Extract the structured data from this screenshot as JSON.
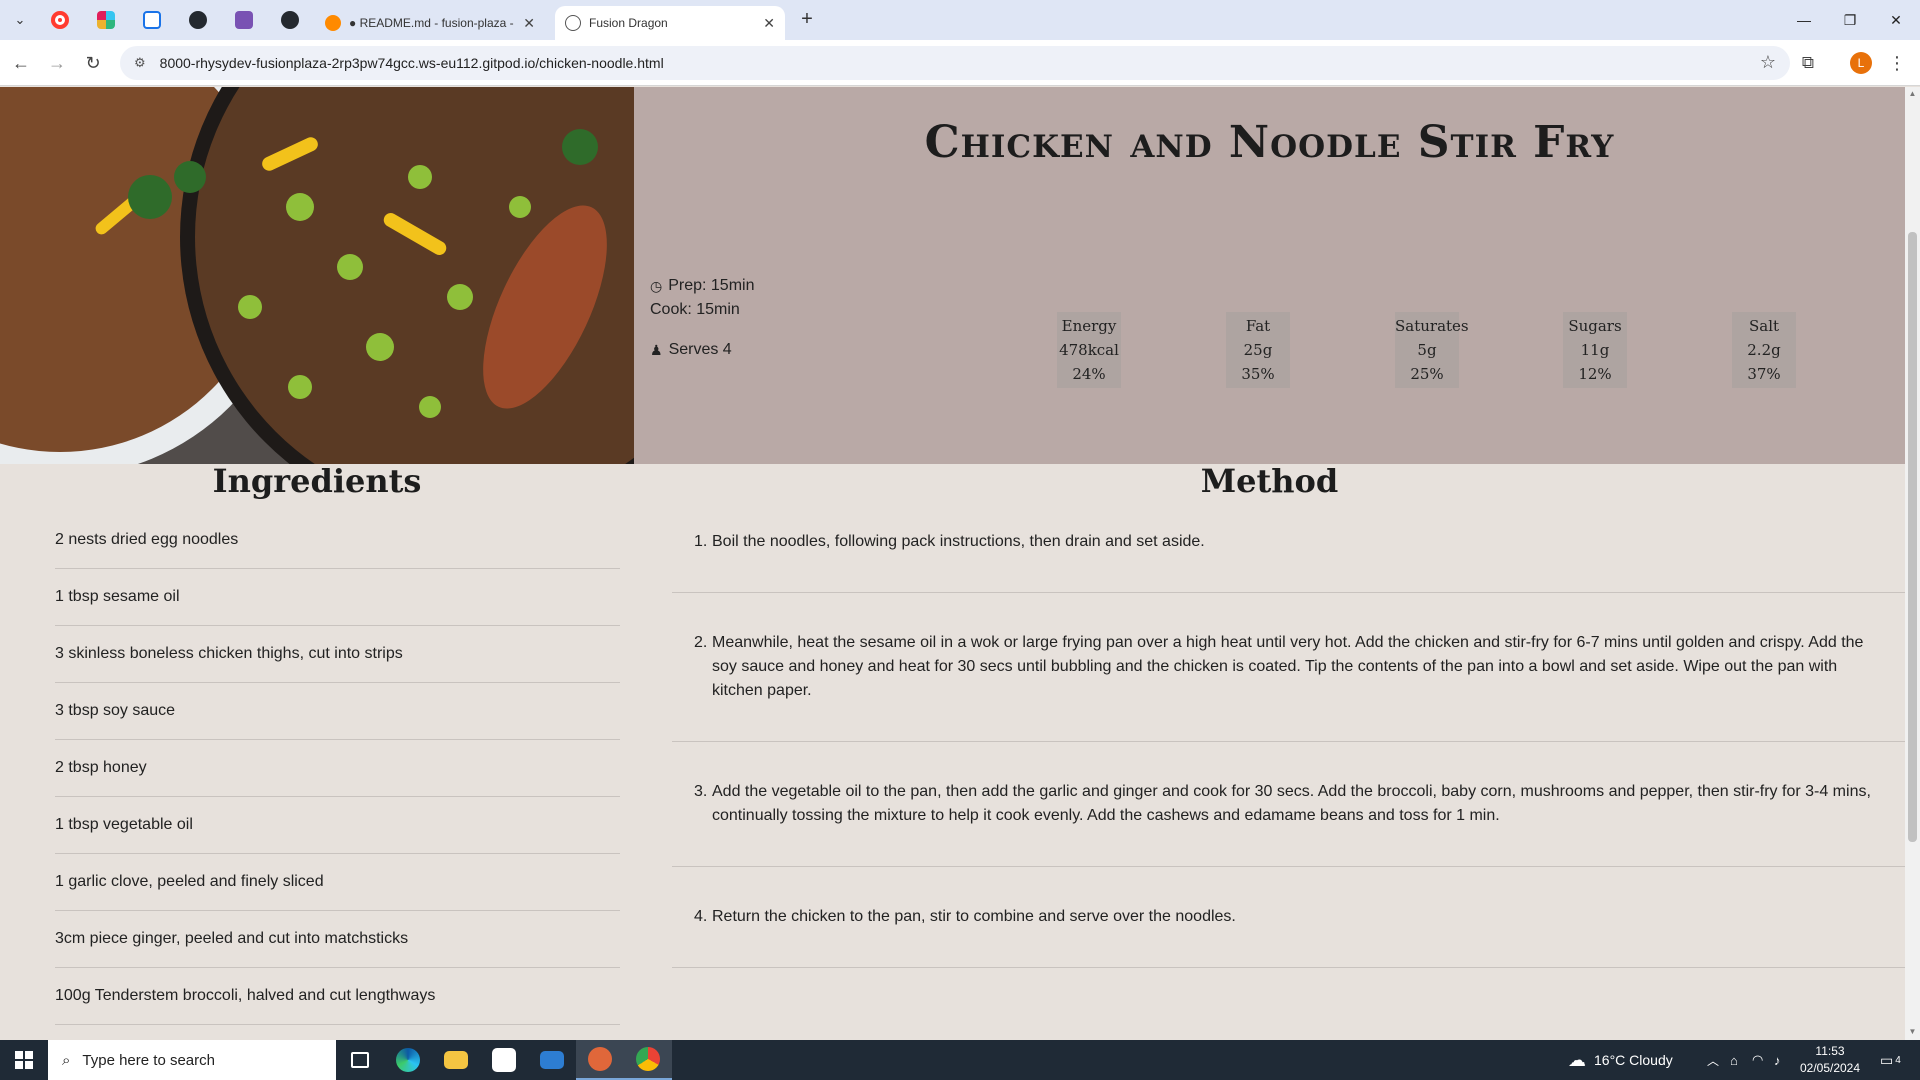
{
  "browser": {
    "tabs": [
      {
        "label": "● README.md - fusion-plaza -",
        "icon": "gitpod-icon",
        "active": false
      },
      {
        "label": "Fusion Dragon",
        "icon": "globe-icon",
        "active": true
      }
    ],
    "url": "8000-rhysydev-fusionplaza-2rp3pw74gcc.ws-eu112.gitpod.io/chicken-noodle.html",
    "profile_initial": "L"
  },
  "recipe": {
    "title": "Chicken and Noodle Stir Fry",
    "prep": "Prep: 15min",
    "cook": "Cook: 15min",
    "serves": "Serves 4",
    "nutrition": [
      {
        "name": "Energy",
        "amount": "478kcal",
        "percent": "24%"
      },
      {
        "name": "Fat",
        "amount": "25g",
        "percent": "35%"
      },
      {
        "name": "Saturates",
        "amount": "5g",
        "percent": "25%"
      },
      {
        "name": "Sugars",
        "amount": "11g",
        "percent": "12%"
      },
      {
        "name": "Salt",
        "amount": "2.2g",
        "percent": "37%"
      }
    ]
  },
  "ingredients": {
    "heading": "Ingredients",
    "items": [
      "2 nests dried egg noodles",
      "1 tbsp sesame oil",
      "3 skinless boneless chicken thighs, cut into strips",
      "3 tbsp soy sauce",
      "2 tbsp honey",
      "1 tbsp vegetable oil",
      "1 garlic clove, peeled and finely sliced",
      "3cm piece ginger, peeled and cut into matchsticks",
      "100g Tenderstem broccoli, halved and cut lengthways"
    ]
  },
  "method": {
    "heading": "Method",
    "steps": [
      {
        "num": "1.",
        "text": "Boil the noodles, following pack instructions, then drain and set aside."
      },
      {
        "num": "2.",
        "text": "Meanwhile, heat the sesame oil in a wok or large frying pan over a high heat until very hot. Add the chicken and stir-fry for 6-7 mins until golden and crispy. Add the soy sauce and honey and heat for 30 secs until bubbling and the chicken is coated. Tip the contents of the pan into a bowl and set aside. Wipe out the pan with kitchen paper."
      },
      {
        "num": "3.",
        "text": "Add the vegetable oil to the pan, then add the garlic and ginger and cook for 30 secs. Add the broccoli, baby corn, mushrooms and pepper, then stir-fry for 3-4 mins, continually tossing the mixture to help it cook evenly. Add the cashews and edamame beans and toss for 1 min."
      },
      {
        "num": "4.",
        "text": "Return the chicken to the pan, stir to combine and serve over the noodles."
      }
    ]
  },
  "taskbar": {
    "search_placeholder": "Type here to search",
    "weather": "16°C  Cloudy",
    "time": "11:53",
    "date": "02/05/2024",
    "notifications": "4"
  }
}
